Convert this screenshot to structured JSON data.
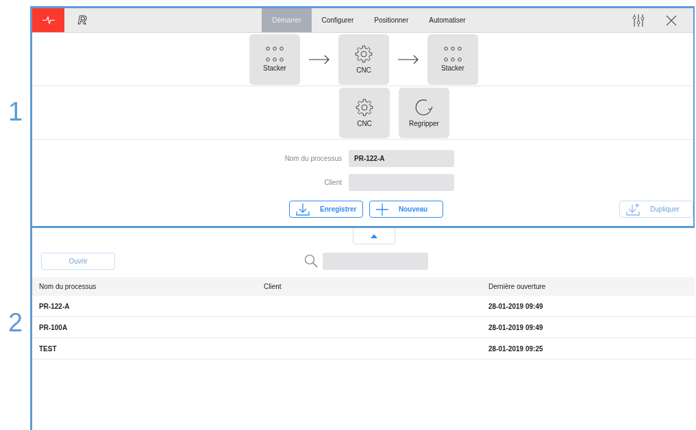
{
  "annotations": [
    "1",
    "2"
  ],
  "top_bar": {
    "logo": "R",
    "tabs": [
      {
        "label": "Démarrer",
        "selected": true
      },
      {
        "label": "Configurer",
        "selected": false
      },
      {
        "label": "Positionner",
        "selected": false
      },
      {
        "label": "Automatiser",
        "selected": false
      }
    ]
  },
  "flow": [
    {
      "label": "Stacker",
      "kind": "dots"
    },
    {
      "label": "CNC",
      "kind": "gear"
    },
    {
      "label": "Stacker",
      "kind": "dots"
    }
  ],
  "steps": [
    {
      "label": "CNC",
      "kind": "gear"
    },
    {
      "label": "Regripper",
      "kind": "rotate"
    }
  ],
  "form": {
    "fields": [
      {
        "label": "Nom du processus",
        "value": "PR-122-A"
      },
      {
        "label": "Client"
      }
    ],
    "buttons": [
      {
        "label": "Enregistrer",
        "kind": "save",
        "disabled": false
      },
      {
        "label": "Nouveau",
        "kind": "add",
        "disabled": false
      }
    ],
    "duplicate": {
      "label": "Dupliquer",
      "kind": "duplicate",
      "disabled": true
    }
  },
  "list": {
    "open_button": {
      "label": "Ouvrir",
      "disabled": true
    },
    "columns": [
      "Nom du processus",
      "Client",
      "Dernière ouverture"
    ],
    "rows": [
      {
        "name": "PR-122-A",
        "last_opened": "28-01-2019  09:49"
      },
      {
        "name": "PR-100A",
        "last_opened": "28-01-2019  09:49"
      },
      {
        "name": "TEST",
        "last_opened": "28-01-2019  09:25"
      }
    ]
  }
}
